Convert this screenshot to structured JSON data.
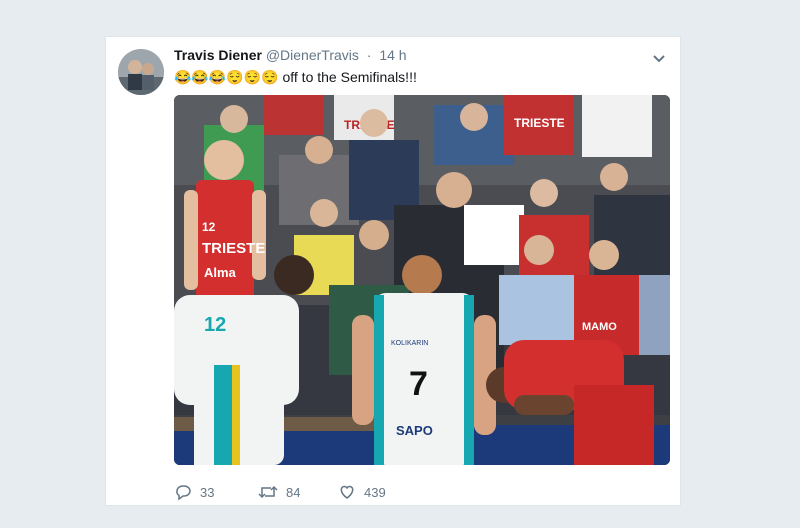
{
  "tweet": {
    "display_name": "Travis Diener",
    "handle": "@DienerTravis",
    "time_ago": "14 h",
    "separator": "·",
    "emojis": "😂😂😂😌😌😌",
    "text": " off to the Semifinals!!!",
    "media": {
      "alt": "",
      "jersey_left_team": "TRIESTE",
      "jersey_left_sponsor": "Alma",
      "jersey_left_number": "12",
      "jersey_teal_left_number": "12",
      "jersey_teal_right_number": "7",
      "jersey_teal_right_sponsor": "KOLIKARIN",
      "jersey_teal_right_sponsor2": "SAPO",
      "crowd_shirt_1": "TRIESTE",
      "crowd_shirt_2": "TRIESTE",
      "crowd_shirt_3": "MAMO"
    },
    "actions": {
      "replies": "33",
      "retweets": "84",
      "likes": "439"
    }
  },
  "colors": {
    "background": "#e6ecf0",
    "card": "#ffffff",
    "secondary_text": "#657786",
    "primary_text": "#14171a",
    "court_blue": "#1c3a7a",
    "jersey_red": "#d32f2f",
    "jersey_white": "#f2f4f4",
    "jersey_teal_trim": "#16a7b0"
  },
  "icons": {
    "reply": "reply-icon",
    "retweet": "retweet-icon",
    "like": "heart-icon",
    "caret": "chevron-down-icon"
  }
}
